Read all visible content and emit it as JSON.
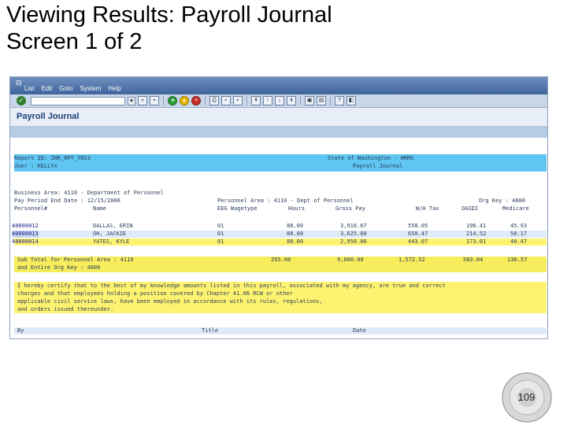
{
  "slide": {
    "title_line1": "Viewing Results: Payroll Journal",
    "title_line2": "Screen 1 of 2",
    "page_number": "109"
  },
  "window": {
    "menu": [
      "List",
      "Edit",
      "Goto",
      "System",
      "Help"
    ],
    "title": "Payroll Journal"
  },
  "report": {
    "header": [
      {
        "left": "Report ID: ZHR_RPT_YNS3",
        "right": "State of Washington - HRMS"
      },
      {
        "left": "User     : KELLYx",
        "right": "Payroll Journal"
      }
    ],
    "business_area": "Business Area: 4110 - Department of Personnel",
    "pay_period": "Pay Period End Date : 12/15/2006",
    "personnel_area": "Personnel Area : 4110 - Dept of Personnel",
    "org_key": "Org Key : 4000",
    "columns": [
      "Personnel#",
      "Name",
      "EEG Wagetype",
      "Hours",
      "Gross Pay",
      "W/H Tax",
      "OASDI",
      "Medicare"
    ],
    "rows": [
      {
        "pernr": "40000012",
        "name": "DALLAS, ERIN",
        "wt": "01",
        "hours": "88.00",
        "gross": "3,916.67",
        "wh": "558.05",
        "oasdi": "196.41",
        "medicare": "45.93"
      },
      {
        "pernr": "40000013",
        "name": "OH, JACKIE",
        "wt": "01",
        "hours": "88.00",
        "gross": "3,625.00",
        "wh": "650.47",
        "oasdi": "214.52",
        "medicare": "50.17"
      },
      {
        "pernr": "40000014",
        "name": "YATES, KYLE",
        "wt": "01",
        "hours": "88.00",
        "gross": "2,950.00",
        "wh": "443.07",
        "oasdi": "173.01",
        "medicare": "40.47"
      }
    ],
    "subtotal_line1": "Sub Total for Personnel Area : 4110",
    "subtotal_line2": "and Entire Org Key : 4000",
    "subtotal": {
      "hours": "265.00",
      "gross": "9,600.00",
      "wh": "1,572.52",
      "oasdi": "583.04",
      "medicare": "136.57"
    },
    "certification": [
      "I hereby certify that to the best of my knowledge amounts listed in this payroll, associated with my agency, are true and correct",
      "charges and that employees holding a position covered by Chapter 41.06 RCW or other",
      "applicable civil service laws, have been employed in accordance with its rules, regulations,",
      "and orders issued thereunder."
    ],
    "signature": {
      "by": "By",
      "title": "Title",
      "date": "Date"
    }
  }
}
